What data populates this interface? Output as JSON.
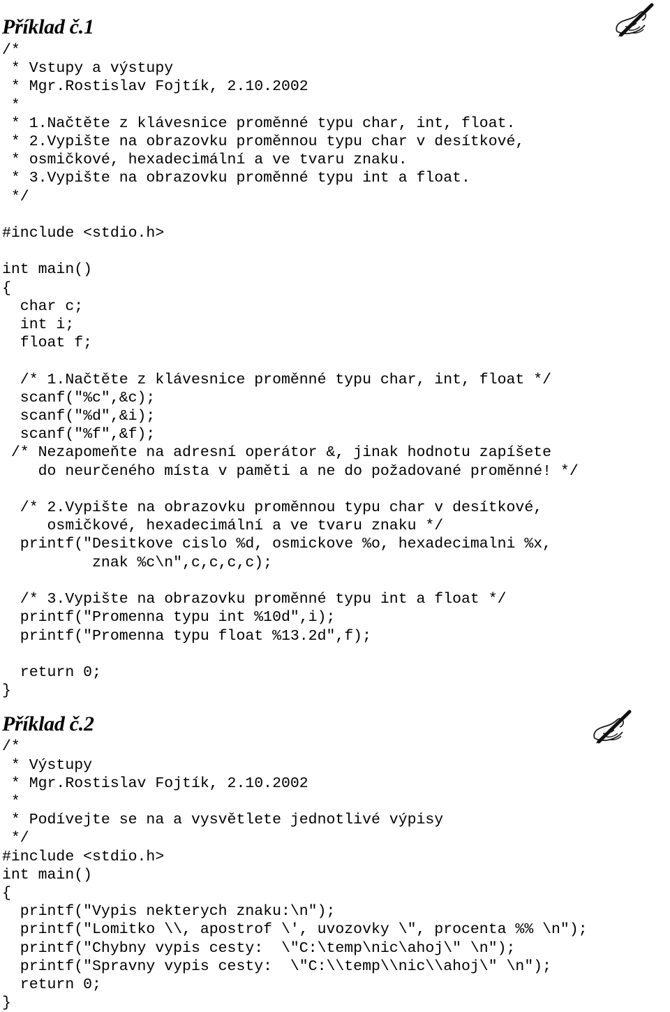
{
  "document": {
    "language": "cs",
    "icons": {
      "writing_hand": "writing-hand-icon"
    }
  },
  "sections": [
    {
      "id": "section-1",
      "heading": "Příklad č.1",
      "code_lines": [
        "/*",
        " * Vstupy a výstupy",
        " * Mgr.Rostislav Fojtík, 2.10.2002",
        " *",
        " * 1.Načtěte z klávesnice proměnné typu char, int, float.",
        " * 2.Vypište na obrazovku proměnnou typu char v desítkové,",
        " * osmičkové, hexadecimální a ve tvaru znaku.",
        " * 3.Vypište na obrazovku proměnné typu int a float.",
        " */",
        "",
        "#include <stdio.h>",
        "",
        "int main()",
        "{",
        "  char c;",
        "  int i;",
        "  float f;",
        "",
        "  /* 1.Načtěte z klávesnice proměnné typu char, int, float */",
        "  scanf(\"%c\",&c);",
        "  scanf(\"%d\",&i);",
        "  scanf(\"%f\",&f);",
        " /* Nezapomeňte na adresní operátor &, jinak hodnotu zapíšete",
        "    do neurčeného místa v paměti a ne do požadované proměnné! */",
        "",
        "  /* 2.Vypište na obrazovku proměnnou typu char v desítkové,",
        "     osmičkové, hexadecimální a ve tvaru znaku */",
        "  printf(\"Desitkove cislo %d, osmickove %o, hexadecimalni %x,",
        "          znak %c\\n\",c,c,c,c);",
        "",
        "  /* 3.Vypište na obrazovku proměnné typu int a float */",
        "  printf(\"Promenna typu int %10d\",i);",
        "  printf(\"Promenna typu float %13.2d\",f);",
        "",
        "  return 0;",
        "}"
      ]
    },
    {
      "id": "section-2",
      "heading": "Příklad č.2",
      "code_lines": [
        "/*",
        " * Výstupy",
        " * Mgr.Rostislav Fojtík, 2.10.2002",
        " *",
        " * Podívejte se na a vysvětlete jednotlivé výpisy",
        " */",
        "#include <stdio.h>",
        "int main()",
        "{",
        "  printf(\"Vypis nekterych znaku:\\n\");",
        "  printf(\"Lomitko \\\\, apostrof \\', uvozovky \\\", procenta %% \\n\");",
        "  printf(\"Chybny vypis cesty:  \\\"C:\\temp\\nic\\ahoj\\\" \\n\");",
        "  printf(\"Spravny vypis cesty:  \\\"C:\\\\temp\\\\nic\\\\ahoj\\\" \\n\");",
        "  return 0;",
        "}"
      ]
    }
  ]
}
